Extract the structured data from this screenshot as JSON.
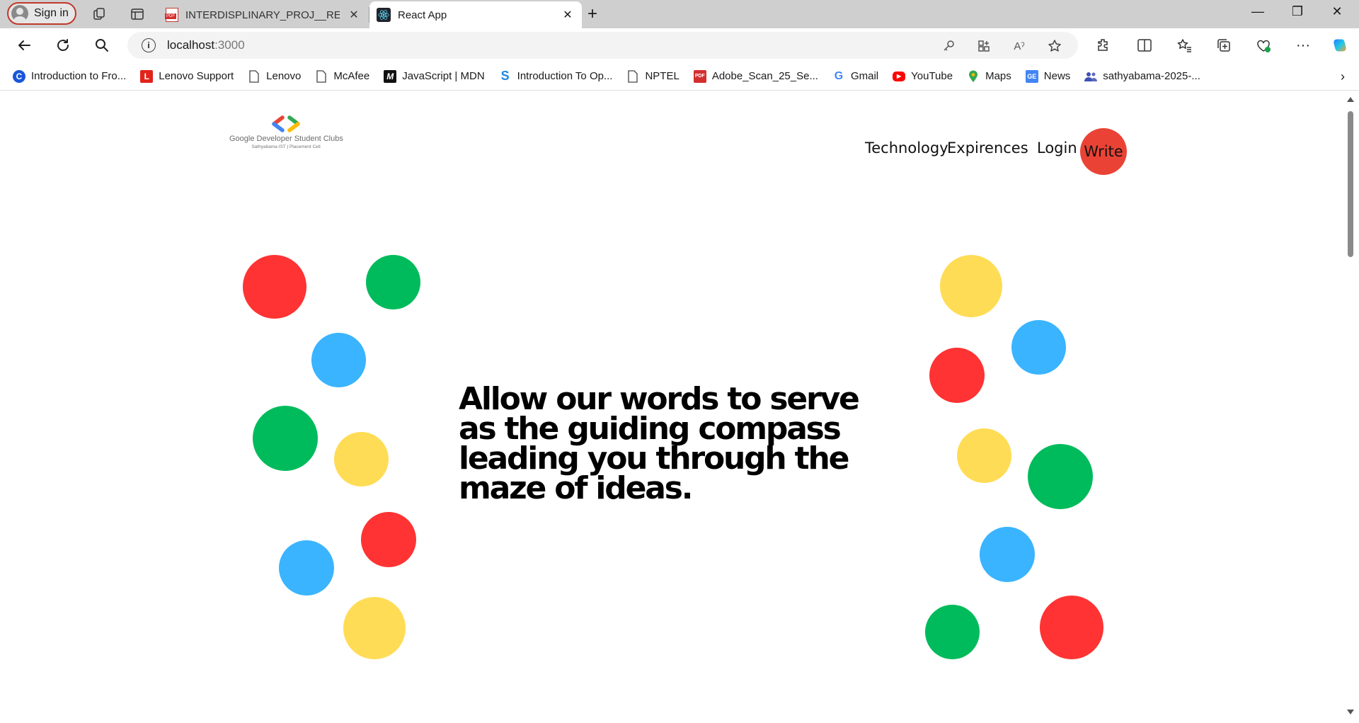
{
  "browser": {
    "signin_label": "Sign in",
    "tabs": [
      {
        "title": "INTERDISPLINARY_PROJ__REPOR",
        "active": false,
        "icon": "pdf-icon"
      },
      {
        "title": "React App",
        "active": true,
        "icon": "react-icon"
      }
    ],
    "address": {
      "host": "localhost",
      "port": ":3000"
    },
    "bookmarks": [
      {
        "label": "Introduction to Fro...",
        "icon": "c-icon",
        "color": "#1a56db"
      },
      {
        "label": "Lenovo Support",
        "icon": "lenovo-l-icon",
        "color": "#e2231a"
      },
      {
        "label": "Lenovo",
        "icon": "page-icon",
        "color": "#444444"
      },
      {
        "label": "McAfee",
        "icon": "page-icon",
        "color": "#444444"
      },
      {
        "label": "JavaScript | MDN",
        "icon": "mdn-icon",
        "color": "#111111"
      },
      {
        "label": "Introduction To Op...",
        "icon": "s-icon",
        "color": "#1e88e5"
      },
      {
        "label": "NPTEL",
        "icon": "page-icon",
        "color": "#444444"
      },
      {
        "label": "Adobe_Scan_25_Se...",
        "icon": "pdf-icon",
        "color": "#d32f2f"
      },
      {
        "label": "Gmail",
        "icon": "google-g-icon",
        "color": "#4285f4"
      },
      {
        "label": "YouTube",
        "icon": "youtube-icon",
        "color": "#ff0000"
      },
      {
        "label": "Maps",
        "icon": "maps-pin-icon",
        "color": "#34a853"
      },
      {
        "label": "News",
        "icon": "google-news-icon",
        "color": "#4285f4"
      },
      {
        "label": "sathyabama-2025-...",
        "icon": "people-icon",
        "color": "#3f51b5"
      }
    ]
  },
  "page": {
    "logo": {
      "line1": "Google Developer Student Clubs",
      "line2": "Sathyabama IST | Placement Cell"
    },
    "nav": {
      "technology": "Technology",
      "experiences": "Expirences",
      "login": "Login",
      "write": "Write"
    },
    "hero_text": "Allow our words to serve as the guiding compass leading you through the maze of ideas.",
    "colors": {
      "red": "#ff3333",
      "green": "#00bb5c",
      "blue": "#3ab4ff",
      "yellow": "#ffdc55",
      "write_button": "#ea4335"
    }
  }
}
